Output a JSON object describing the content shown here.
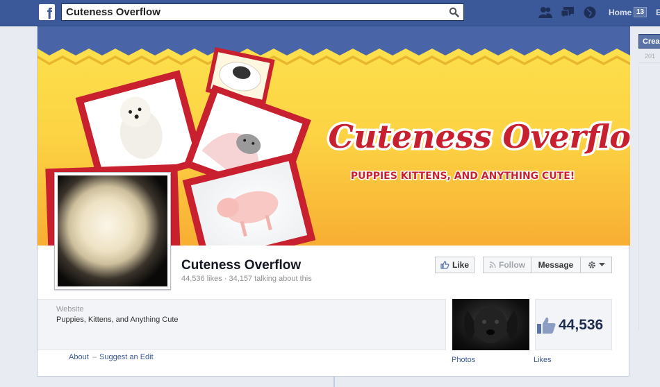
{
  "topbar": {
    "logo": "f",
    "search_value": "Cuteness Overflow",
    "home_label": "Home",
    "home_count": "13",
    "cut_text": "E",
    "icons": [
      "friend-requests-icon",
      "messages-icon",
      "notifications-globe-icon",
      "search-icon"
    ]
  },
  "right_column": {
    "create_label": "Crea",
    "sub_text": "201"
  },
  "cover": {
    "title": "Cuteness Overflow",
    "tagline": "PUPPIES KITTENS, AND ANYTHING CUTE!",
    "colors": {
      "banner": "#4a64a8",
      "yellow": "#fcd846",
      "orange": "#f9b235",
      "frame_red": "#c8202f"
    }
  },
  "page": {
    "name": "Cuteness Overflow",
    "stats": "44,536 likes · 34,157 talking about this",
    "like_label": "Like",
    "follow_label": "Follow",
    "message_label": "Message",
    "info_label": "Website",
    "info_value": "Puppies, Kittens, and Anything Cute",
    "about_label": "About",
    "separator": "–",
    "suggest_label": "Suggest an Edit",
    "photos_label": "Photos",
    "likes_label": "Likes",
    "likes_count": "44,536"
  }
}
